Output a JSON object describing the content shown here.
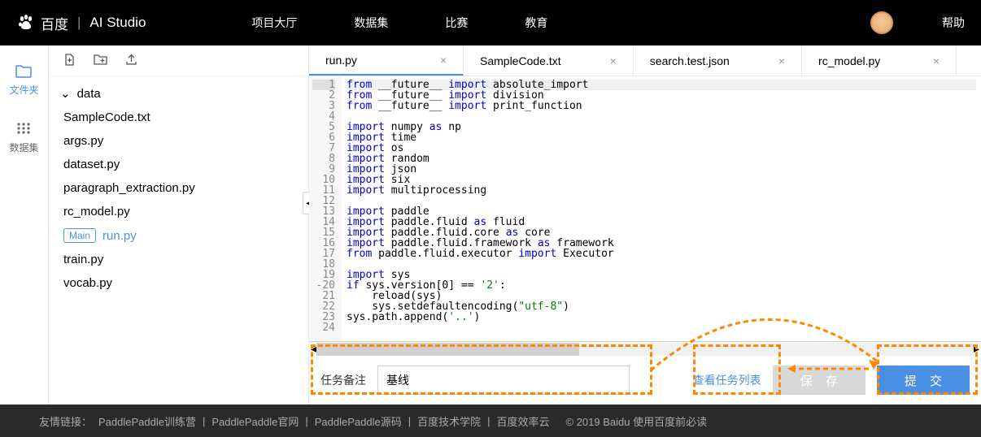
{
  "header": {
    "logo_text": "百度",
    "logo_suffix": "AI Studio",
    "nav": [
      "项目大厅",
      "数据集",
      "比赛",
      "教育"
    ],
    "help": "帮助"
  },
  "sidebar_icons": {
    "files": "文件夹",
    "datasets": "数据集"
  },
  "file_tree": {
    "folder": "data",
    "files": [
      "SampleCode.txt",
      "args.py",
      "dataset.py",
      "paragraph_extraction.py",
      "rc_model.py",
      "run.py",
      "train.py",
      "vocab.py"
    ],
    "main_badge": "Main",
    "active": "run.py"
  },
  "tabs": [
    {
      "label": "run.py",
      "active": true
    },
    {
      "label": "SampleCode.txt"
    },
    {
      "label": "search.test.json"
    },
    {
      "label": "rc_model.py"
    }
  ],
  "code": [
    {
      "n": 1,
      "t": "from __future__ import absolute_import",
      "h": true
    },
    {
      "n": 2,
      "t": "from __future__ import division"
    },
    {
      "n": 3,
      "t": "from __future__ import print_function"
    },
    {
      "n": 4,
      "t": ""
    },
    {
      "n": 5,
      "t": "import numpy as np"
    },
    {
      "n": 6,
      "t": "import time"
    },
    {
      "n": 7,
      "t": "import os"
    },
    {
      "n": 8,
      "t": "import random"
    },
    {
      "n": 9,
      "t": "import json"
    },
    {
      "n": 10,
      "t": "import six"
    },
    {
      "n": 11,
      "t": "import multiprocessing"
    },
    {
      "n": 12,
      "t": ""
    },
    {
      "n": 13,
      "t": "import paddle"
    },
    {
      "n": 14,
      "t": "import paddle.fluid as fluid"
    },
    {
      "n": 15,
      "t": "import paddle.fluid.core as core"
    },
    {
      "n": 16,
      "t": "import paddle.fluid.framework as framework"
    },
    {
      "n": 17,
      "t": "from paddle.fluid.executor import Executor"
    },
    {
      "n": 18,
      "t": ""
    },
    {
      "n": 19,
      "t": "import sys"
    },
    {
      "n": 20,
      "t": "if sys.version[0] == '2':",
      "marker": "-"
    },
    {
      "n": 21,
      "t": "    reload(sys)"
    },
    {
      "n": 22,
      "t": "    sys.setdefaultencoding(\"utf-8\")"
    },
    {
      "n": 23,
      "t": "sys.path.append('..')"
    },
    {
      "n": 24,
      "t": ""
    }
  ],
  "bottom": {
    "label": "任务备注",
    "input_value": "基线",
    "view_tasks": "查看任务列表",
    "save": "保 存",
    "submit": "提 交"
  },
  "footer": {
    "label": "友情链接：",
    "links": [
      "PaddlePaddle训练营",
      "PaddlePaddle官网",
      "PaddlePaddle源码",
      "百度技术学院",
      "百度效率云"
    ],
    "copyright": "© 2019 Baidu 使用百度前必读"
  }
}
